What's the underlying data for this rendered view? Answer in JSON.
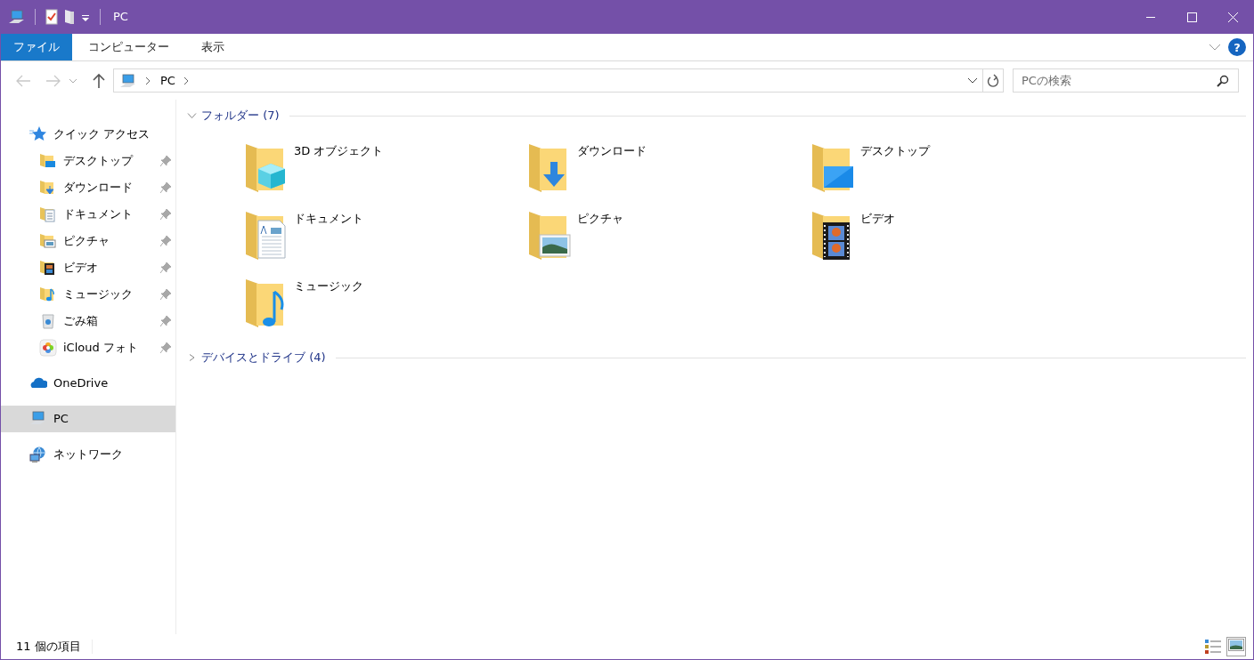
{
  "window": {
    "title": "PC"
  },
  "ribbon": {
    "tabs": [
      {
        "label": "ファイル",
        "selected": true
      },
      {
        "label": "コンピューター",
        "selected": false
      },
      {
        "label": "表示",
        "selected": false
      }
    ],
    "help_label": "?"
  },
  "navigation_bar": {
    "back_disabled": true,
    "forward_disabled": true,
    "path": [
      "PC"
    ],
    "search": {
      "placeholder": "PCの検索"
    }
  },
  "sidebar": {
    "items": [
      {
        "label": "クイック アクセス",
        "kind": "star",
        "selected": false,
        "children": [
          {
            "label": "デスクトップ",
            "kind": "desktop",
            "pinned": true,
            "selected": false
          },
          {
            "label": "ダウンロード",
            "kind": "downloads",
            "pinned": true,
            "selected": false
          },
          {
            "label": "ドキュメント",
            "kind": "documents",
            "pinned": true,
            "selected": false
          },
          {
            "label": "ピクチャ",
            "kind": "pictures",
            "pinned": true,
            "selected": false
          },
          {
            "label": "ビデオ",
            "kind": "videos",
            "pinned": true,
            "selected": false
          },
          {
            "label": "ミュージック",
            "kind": "music",
            "pinned": true,
            "selected": false
          },
          {
            "label": "ごみ箱",
            "kind": "trash",
            "pinned": true,
            "selected": false
          },
          {
            "label": "iCloud フォト",
            "kind": "photos",
            "pinned": true,
            "selected": false
          }
        ]
      },
      {
        "label": "OneDrive",
        "kind": "cloud",
        "selected": false
      },
      {
        "label": "PC",
        "kind": "pc",
        "selected": true
      },
      {
        "label": "ネットワーク",
        "kind": "network",
        "selected": false
      }
    ]
  },
  "groups": [
    {
      "title": "フォルダー (7)",
      "expanded": true,
      "items": [
        {
          "label": "3D オブジェクト",
          "kind": "objects3d"
        },
        {
          "label": "ダウンロード",
          "kind": "downloads"
        },
        {
          "label": "デスクトップ",
          "kind": "desktop"
        },
        {
          "label": "ドキュメント",
          "kind": "documents"
        },
        {
          "label": "ピクチャ",
          "kind": "pictures"
        },
        {
          "label": "ビデオ",
          "kind": "videos"
        },
        {
          "label": "ミュージック",
          "kind": "music"
        }
      ]
    },
    {
      "title": "デバイスとドライブ (4)",
      "expanded": false
    }
  ],
  "status_bar": {
    "text": "11 個の項目",
    "views": [
      {
        "kind": "details",
        "selected": false
      },
      {
        "kind": "large-icons",
        "selected": true
      }
    ]
  }
}
